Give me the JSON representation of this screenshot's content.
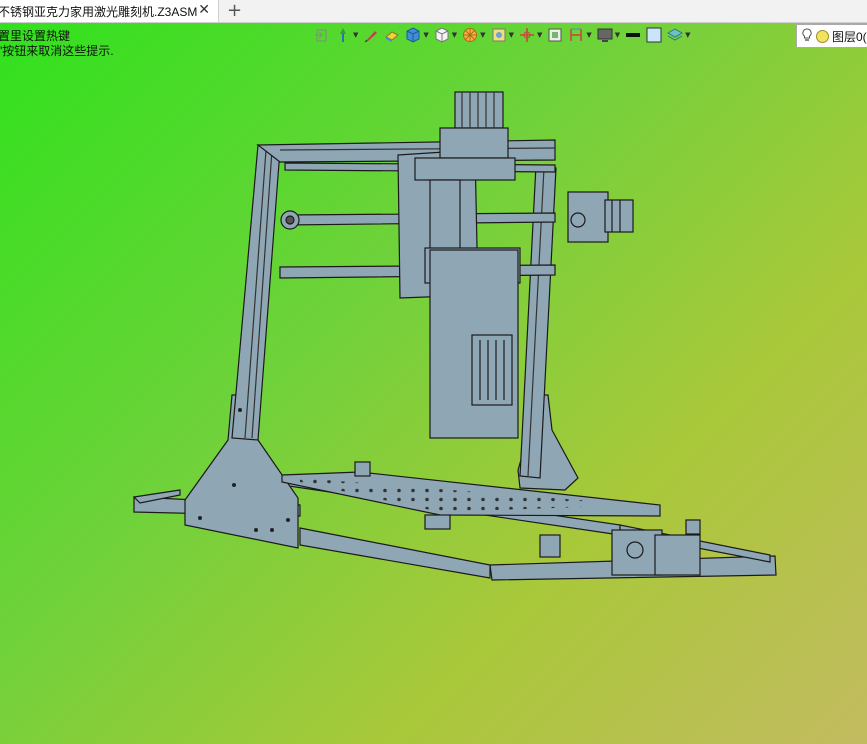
{
  "tab": {
    "title": "不锈钢亚克力家用激光雕刻机.Z3ASM",
    "close": "✕",
    "add": "+"
  },
  "hints": {
    "line1": "置里设置热键",
    "line2": "\"按钮来取消这些提示."
  },
  "toolbar": {
    "icons": [
      "exit-icon",
      "pin-icon",
      "brush-icon",
      "eraser-icon",
      "cube-blue-icon",
      "cube-white-icon",
      "render-mode-icon",
      "view-orient-icon",
      "axis-icon",
      "zoom-fit-icon",
      "section-icon",
      "display-icon",
      "line-style-icon",
      "color-square-icon",
      "layers-icon"
    ]
  },
  "layer": {
    "label": "图层0("
  },
  "colors": {
    "accent_blue": "#3d8fd8",
    "model_fill": "#8fa7b5",
    "model_stroke": "#1a1a1a"
  }
}
